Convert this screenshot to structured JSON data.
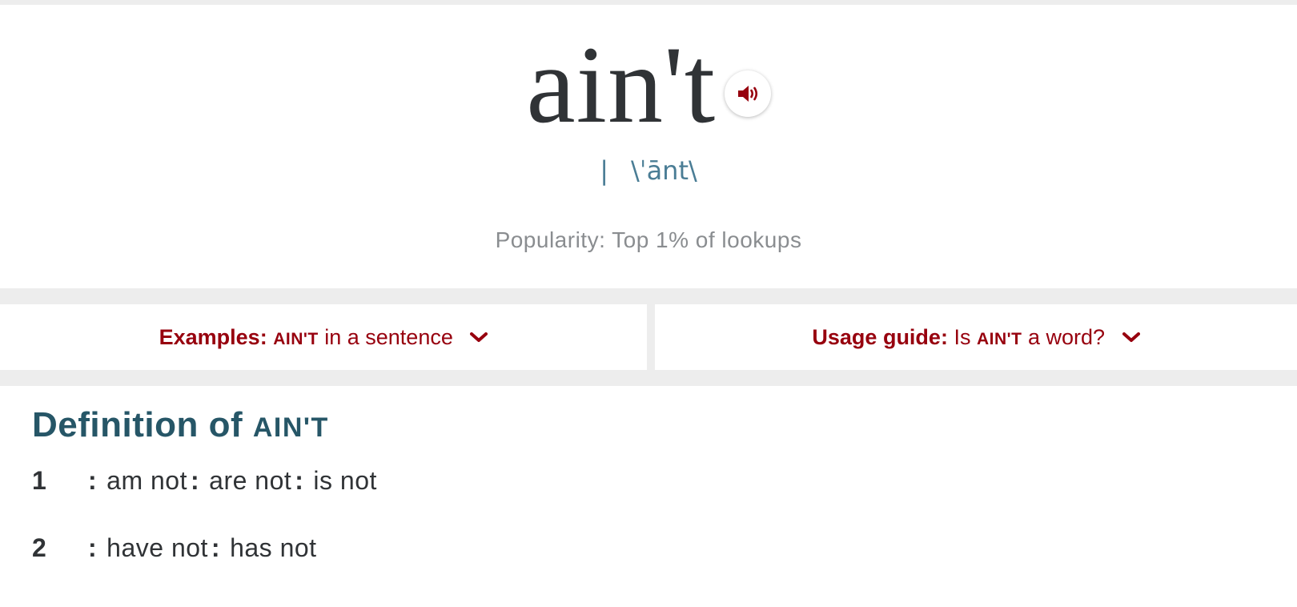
{
  "entry": {
    "headword": "ain't",
    "pronunciation_separator": "|",
    "pronunciation": "\\ˈānt\\",
    "popularity": "Popularity: Top 1% of lookups",
    "audio_icon": "speaker-icon"
  },
  "cards": {
    "examples": {
      "bold": "Examples:",
      "word": "AIN'T",
      "text": "in a sentence"
    },
    "usage": {
      "bold": "Usage guide:",
      "pre": "Is",
      "word": "AIN'T",
      "text": "a word?"
    }
  },
  "definition": {
    "title_prefix": "Definition of",
    "title_word": "AIN'T",
    "senses": [
      {
        "num": "1",
        "parts": [
          "am not",
          "are not",
          "is not"
        ]
      },
      {
        "num": "2",
        "parts": [
          "have not",
          "has not"
        ]
      }
    ]
  },
  "colors": {
    "accent_red": "#97000e",
    "pron_blue": "#4a7d95",
    "title_blue": "#265667",
    "text_dark": "#303336"
  }
}
